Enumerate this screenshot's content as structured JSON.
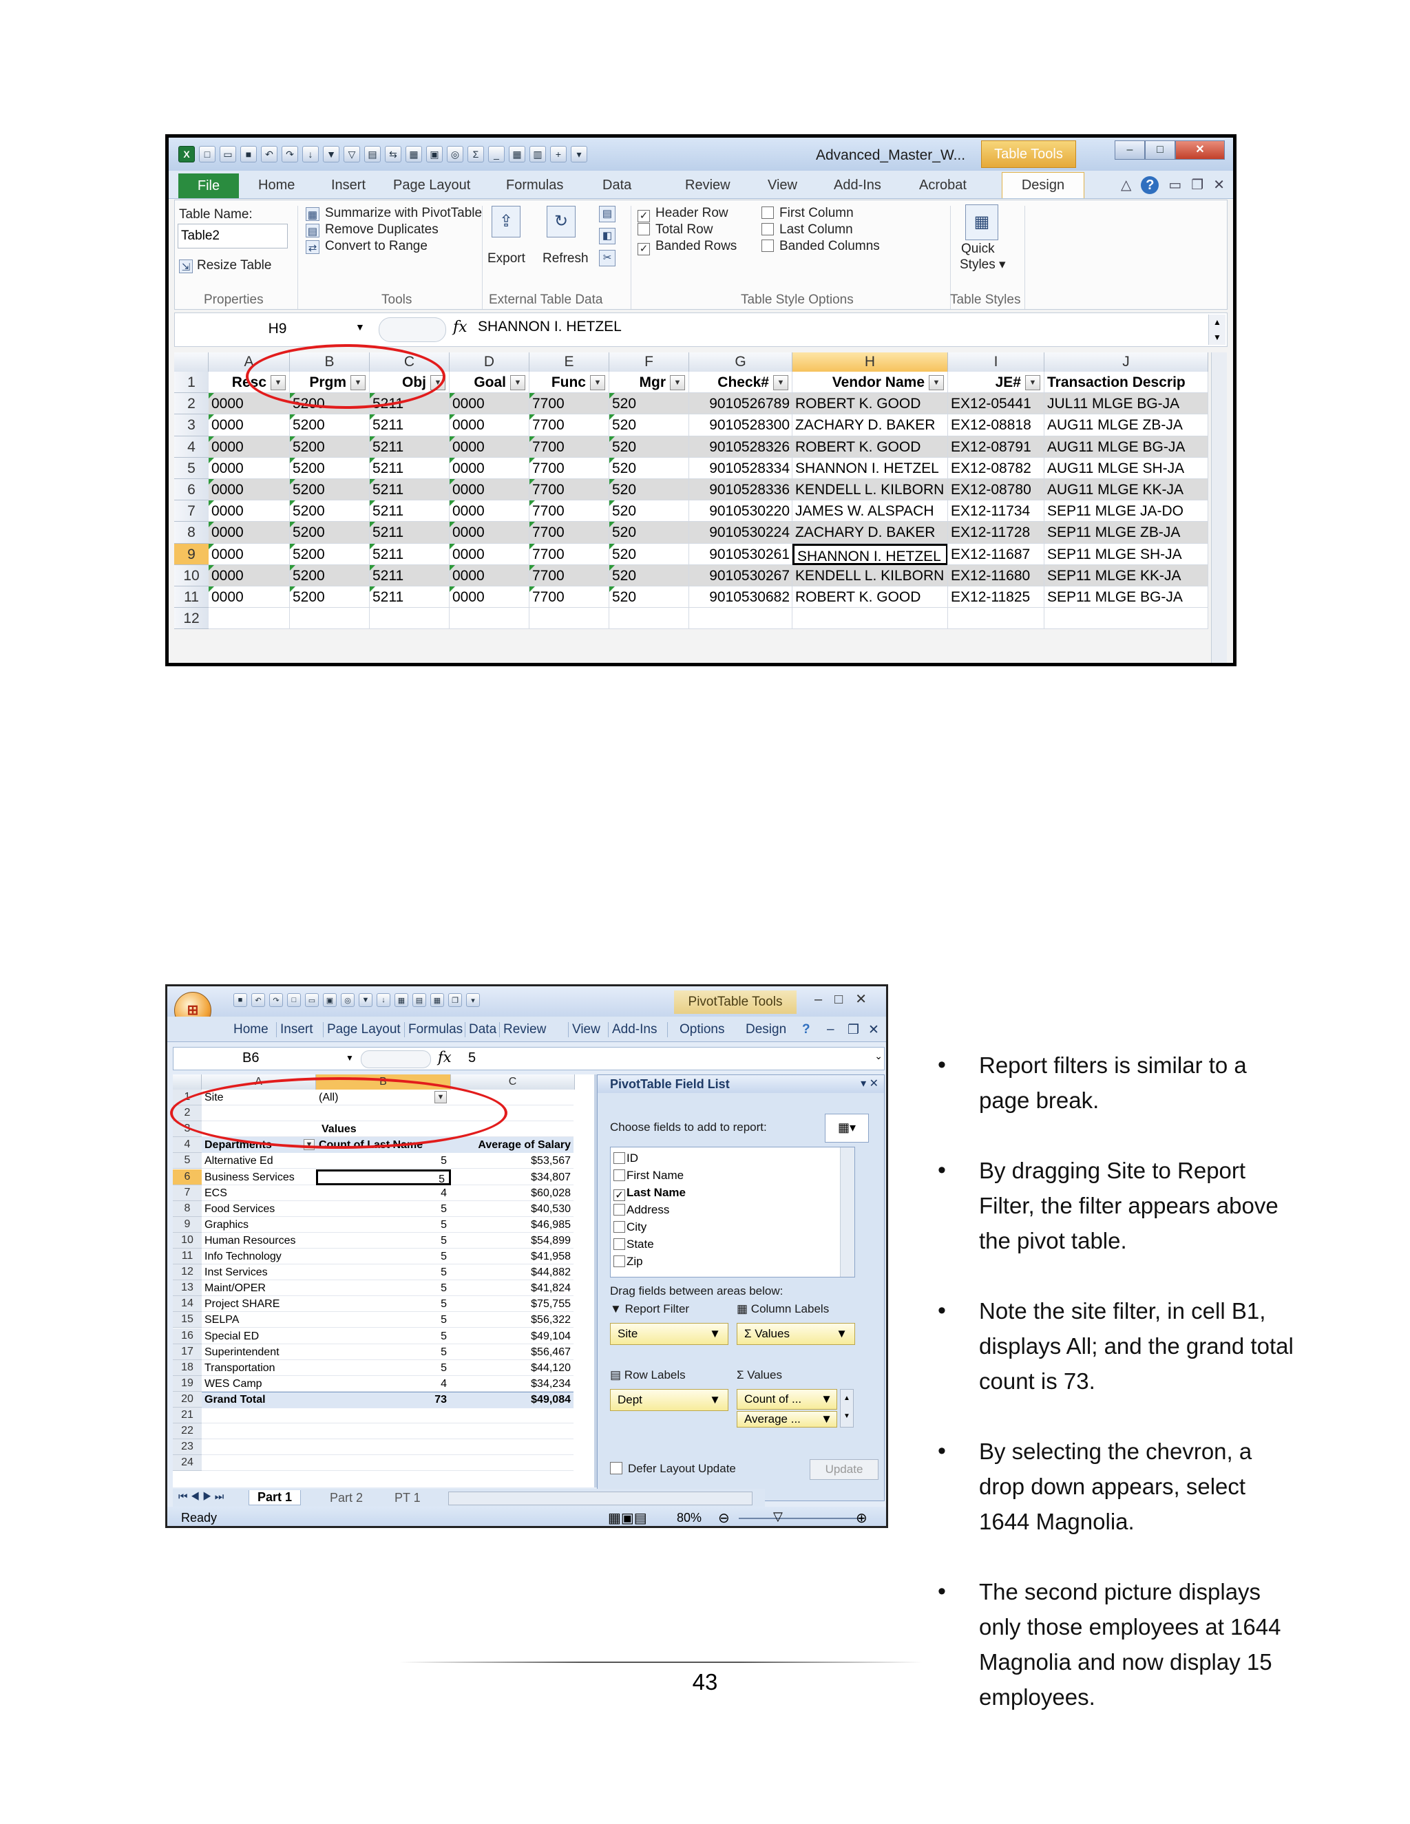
{
  "shot1": {
    "title": "Advanced_Master_W...",
    "context_tab": "Table Tools",
    "tabs": [
      "File",
      "Home",
      "Insert",
      "Page Layout",
      "Formulas",
      "Data",
      "Review",
      "View",
      "Add-Ins",
      "Acrobat",
      "Design"
    ],
    "ribbon": {
      "table_name_label": "Table Name:",
      "table_name_value": "Table2",
      "resize_table": "Resize Table",
      "summarize": "Summarize with PivotTable",
      "remove_duplicates": "Remove Duplicates",
      "convert_to_range": "Convert to Range",
      "export": "Export",
      "refresh": "Refresh",
      "header_row": "Header Row",
      "total_row": "Total Row",
      "banded_rows": "Banded Rows",
      "first_column": "First Column",
      "last_column": "Last Column",
      "banded_columns": "Banded Columns",
      "quick": "Quick",
      "styles": "Styles",
      "groups": [
        "Properties",
        "Tools",
        "External Table Data",
        "Table Style Options",
        "Table Styles"
      ]
    },
    "name_box": "H9",
    "fx": "fx",
    "formula": "SHANNON I. HETZEL",
    "columns": [
      "A",
      "B",
      "C",
      "D",
      "E",
      "F",
      "G",
      "H",
      "I",
      "J"
    ],
    "headers": [
      "Resc",
      "Prgm",
      "Obj",
      "Goal",
      "Func",
      "Mgr",
      "Check#",
      "Vendor Name",
      "JE#",
      "Transaction Descrip"
    ],
    "rows": [
      [
        "0000",
        "5200",
        "5211",
        "0000",
        "7700",
        "520",
        "9010526789",
        "ROBERT K. GOOD",
        "EX12-05441",
        "JUL11 MLGE BG-JA"
      ],
      [
        "0000",
        "5200",
        "5211",
        "0000",
        "7700",
        "520",
        "9010528300",
        "ZACHARY D. BAKER",
        "EX12-08818",
        "AUG11 MLGE ZB-JA"
      ],
      [
        "0000",
        "5200",
        "5211",
        "0000",
        "7700",
        "520",
        "9010528326",
        "ROBERT K. GOOD",
        "EX12-08791",
        "AUG11 MLGE BG-JA"
      ],
      [
        "0000",
        "5200",
        "5211",
        "0000",
        "7700",
        "520",
        "9010528334",
        "SHANNON I. HETZEL",
        "EX12-08782",
        "AUG11 MLGE SH-JA"
      ],
      [
        "0000",
        "5200",
        "5211",
        "0000",
        "7700",
        "520",
        "9010528336",
        "KENDELL L. KILBORN",
        "EX12-08780",
        "AUG11 MLGE KK-JA"
      ],
      [
        "0000",
        "5200",
        "5211",
        "0000",
        "7700",
        "520",
        "9010530220",
        "JAMES W. ALSPACH",
        "EX12-11734",
        "SEP11 MLGE JA-DO"
      ],
      [
        "0000",
        "5200",
        "5211",
        "0000",
        "7700",
        "520",
        "9010530224",
        "ZACHARY D. BAKER",
        "EX12-11728",
        "SEP11 MLGE ZB-JA"
      ],
      [
        "0000",
        "5200",
        "5211",
        "0000",
        "7700",
        "520",
        "9010530261",
        "SHANNON I. HETZEL",
        "EX12-11687",
        "SEP11 MLGE SH-JA"
      ],
      [
        "0000",
        "5200",
        "5211",
        "0000",
        "7700",
        "520",
        "9010530267",
        "KENDELL L. KILBORN",
        "EX12-11680",
        "SEP11 MLGE KK-JA"
      ],
      [
        "0000",
        "5200",
        "5211",
        "0000",
        "7700",
        "520",
        "9010530682",
        "ROBERT K. GOOD",
        "EX12-11825",
        "SEP11 MLGE BG-JA"
      ]
    ],
    "row_numbers": [
      "1",
      "2",
      "3",
      "4",
      "5",
      "6",
      "7",
      "8",
      "9",
      "10",
      "11",
      "12"
    ]
  },
  "shot2": {
    "context_tab": "PivotTable Tools",
    "tabs": [
      "Home",
      "Insert",
      "Page Layout",
      "Formulas",
      "Data",
      "Review",
      "View",
      "Add-Ins",
      "Options",
      "Design"
    ],
    "name_box": "B6",
    "fx": "fx",
    "formula": "5",
    "columns": [
      "A",
      "B",
      "C"
    ],
    "filter_label": "Site",
    "filter_value": "(All)",
    "values_label": "Values",
    "col_headers": [
      "Departments",
      "Count of Last Name",
      "Average of Salary"
    ],
    "rows": [
      [
        "Alternative Ed",
        "5",
        "$53,567"
      ],
      [
        "Business Services",
        "5",
        "$34,807"
      ],
      [
        "ECS",
        "4",
        "$60,028"
      ],
      [
        "Food Services",
        "5",
        "$40,530"
      ],
      [
        "Graphics",
        "5",
        "$46,985"
      ],
      [
        "Human Resources",
        "5",
        "$54,899"
      ],
      [
        "Info Technology",
        "5",
        "$41,958"
      ],
      [
        "Inst Services",
        "5",
        "$44,882"
      ],
      [
        "Maint/OPER",
        "5",
        "$41,824"
      ],
      [
        "Project SHARE",
        "5",
        "$75,755"
      ],
      [
        "SELPA",
        "5",
        "$56,322"
      ],
      [
        "Special ED",
        "5",
        "$49,104"
      ],
      [
        "Superintendent",
        "5",
        "$56,467"
      ],
      [
        "Transportation",
        "5",
        "$44,120"
      ],
      [
        "WES Camp",
        "4",
        "$34,234"
      ]
    ],
    "grand_total": [
      "Grand Total",
      "73",
      "$49,084"
    ],
    "row_numbers": [
      "1",
      "2",
      "3",
      "4",
      "5",
      "6",
      "7",
      "8",
      "9",
      "10",
      "11",
      "12",
      "13",
      "14",
      "15",
      "16",
      "17",
      "18",
      "19",
      "20",
      "21",
      "22",
      "23",
      "24"
    ],
    "field_list": {
      "title": "PivotTable Field List",
      "choose": "Choose fields to add to report:",
      "fields": [
        {
          "name": "ID",
          "checked": false
        },
        {
          "name": "First Name",
          "checked": false
        },
        {
          "name": "Last Name",
          "checked": true
        },
        {
          "name": "Address",
          "checked": false
        },
        {
          "name": "City",
          "checked": false
        },
        {
          "name": "State",
          "checked": false
        },
        {
          "name": "Zip",
          "checked": false
        }
      ],
      "drag": "Drag fields between areas below:",
      "report_filter": "Report Filter",
      "column_labels": "Column Labels",
      "row_labels": "Row Labels",
      "values": "Values",
      "site": "Site",
      "values_item": "Values",
      "dept": "Dept",
      "count_of": "Count of ...",
      "average": "Average ...",
      "defer": "Defer Layout Update",
      "update": "Update"
    },
    "sheet_tabs": [
      "Part 1",
      "Part 2",
      "PT 1"
    ],
    "status": "Ready",
    "zoom": "80%"
  },
  "bullets": [
    "Report filters is similar to a page break.",
    "By dragging Site to Report Filter, the filter appears above the pivot table.",
    "Note the site filter, in cell B1, displays All; and the grand total count is 73.",
    "By selecting the chevron, a drop down appears, select 1644 Magnolia.",
    "The second picture displays only those employees at 1644 Magnolia and now display 15 employees."
  ],
  "page_number": "43"
}
